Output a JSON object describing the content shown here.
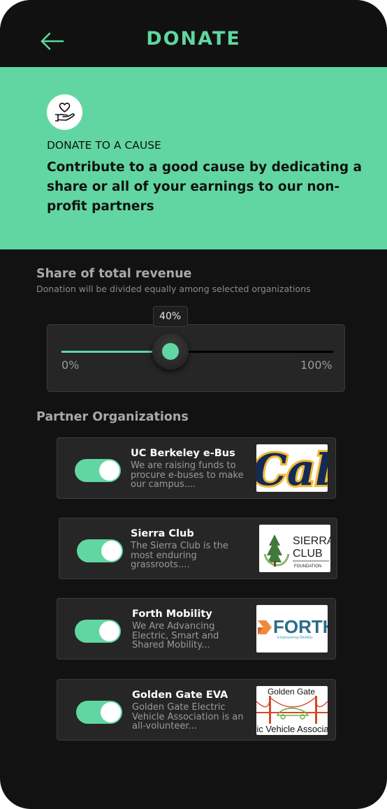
{
  "header": {
    "title": "DONATE",
    "back_icon": "arrow-left-icon"
  },
  "hero": {
    "icon": "hand-heart-icon",
    "kicker": "DONATE TO A CAUSE",
    "text": "Contribute to a good cause by dedicating a share or all of your earnings to our non-profit partners"
  },
  "share": {
    "title": "Share of total revenue",
    "subtitle": "Donation will be divided equally among selected organizations",
    "value_label": "40%",
    "value": 40,
    "min_label": "0%",
    "max_label": "100%"
  },
  "partners": {
    "title": "Partner Organizations",
    "items": [
      {
        "name": "UC Berkeley e-Bus",
        "desc": "We are raising funds to procure e-buses to make our campus....",
        "enabled": true,
        "logo_text": "Cal"
      },
      {
        "name": "Sierra Club",
        "desc": "The Sierra Club is the most enduring grassroots....",
        "enabled": true,
        "logo_text": "SIERRA CLUB FOUNDATION"
      },
      {
        "name": "Forth Mobility",
        "desc": "We Are Advancing Electric, Smart and Shared Mobility...",
        "enabled": true,
        "logo_text": "FORTH Empowering Mobility"
      },
      {
        "name": "Golden Gate EVA",
        "desc": "Golden Gate Electric Vehicle Association is an all-volunteer...",
        "enabled": true,
        "logo_text": "Golden Gate Electric Vehicle Association"
      }
    ]
  },
  "colors": {
    "accent": "#62d6a2",
    "background": "#121212",
    "card": "#262626"
  }
}
